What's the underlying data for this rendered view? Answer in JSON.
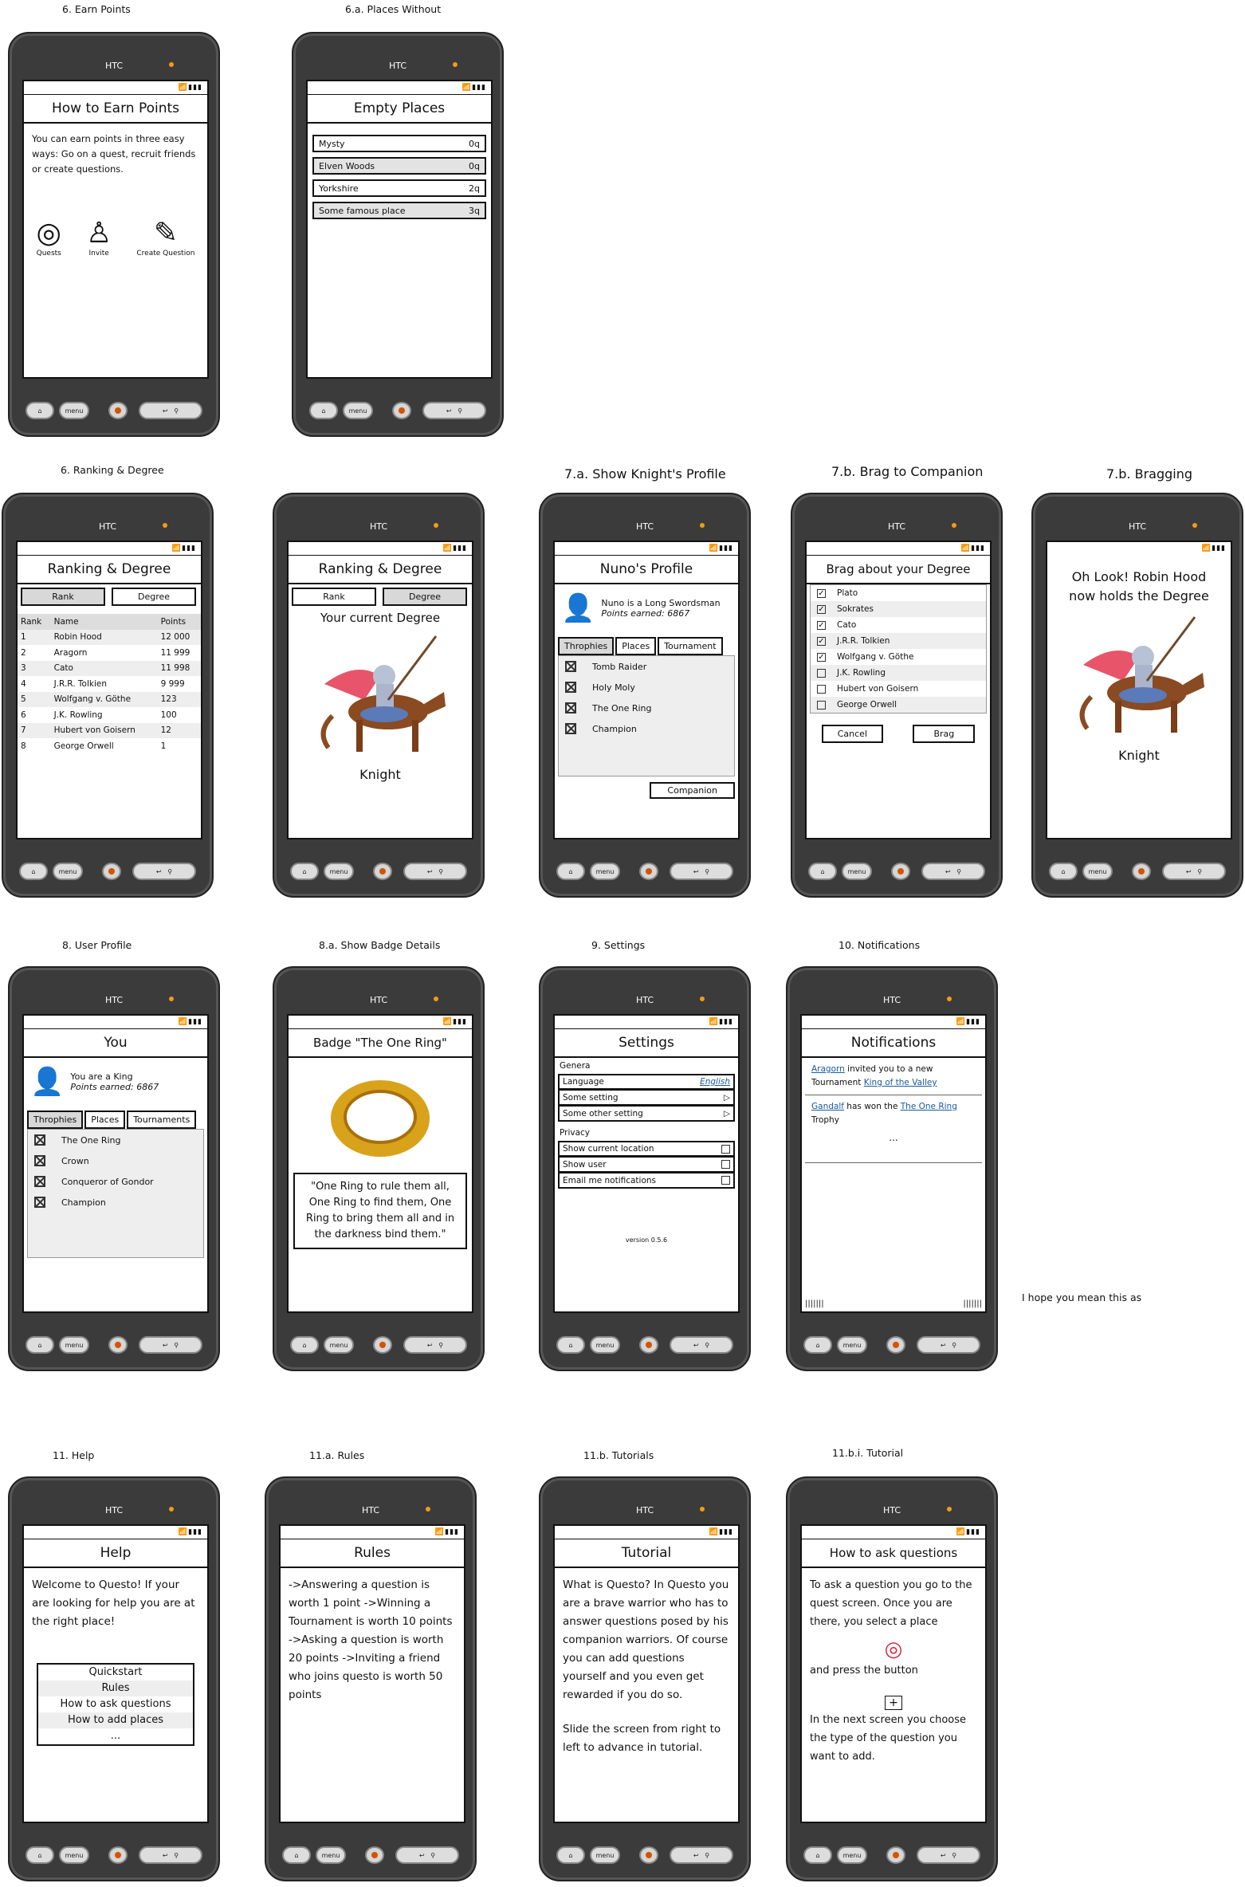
{
  "labels": {
    "earn": "6. Earn Points",
    "places": "6.a. Places Without",
    "ranking": "6. Ranking & Degree",
    "knight": "7.a. Show Knight's Profile",
    "brag": "7.b. Brag to Companion",
    "bragging": "7.b. Bragging",
    "user": "8. User Profile",
    "badge": "8.a. Show Badge Details",
    "settings": "9. Settings",
    "notif": "10. Notifications",
    "help": "11. Help",
    "rules": "11.a. Rules",
    "tutorials": "11.b. Tutorials",
    "tutorial": "11.b.i. Tutorial",
    "note": "I hope you mean this as"
  },
  "phone": {
    "brand": "HTC",
    "menu": "menu"
  },
  "earn": {
    "title": "How to Earn Points",
    "text": "You can earn points in three easy ways: Go on a quest, recruit friends or create questions.",
    "icons": [
      "Quests",
      "Invite",
      "Create Question"
    ]
  },
  "places": {
    "title": "Empty Places",
    "items": [
      {
        "name": "Mysty",
        "q": "0q"
      },
      {
        "name": "Elven Woods",
        "q": "0q"
      },
      {
        "name": "Yorkshire",
        "q": "2q"
      },
      {
        "name": "Some famous place",
        "q": "3q"
      }
    ]
  },
  "ranking": {
    "title": "Ranking & Degree",
    "tabs": [
      "Rank",
      "Degree"
    ],
    "headers": [
      "Rank",
      "Name",
      "Points"
    ],
    "rows": [
      [
        "1",
        "Robin Hood",
        "12 000"
      ],
      [
        "2",
        "Aragorn",
        "11 999"
      ],
      [
        "3",
        "Cato",
        "11 998"
      ],
      [
        "4",
        "J.R.R. Tolkien",
        "9 999"
      ],
      [
        "5",
        "Wolfgang v. Göthe",
        "123"
      ],
      [
        "6",
        "J.K. Rowling",
        "100"
      ],
      [
        "7",
        "Hubert von Goisern",
        "12"
      ],
      [
        "8",
        "George Orwell",
        "1"
      ]
    ],
    "degree_heading": "Your current Degree",
    "degree": "Knight"
  },
  "knight": {
    "title": "Nuno's Profile",
    "desc": "Nuno is a Long Swordsman",
    "points": "Points earned: 6867",
    "tabs": [
      "Throphies",
      "Places",
      "Tournament"
    ],
    "items": [
      "Tomb Raider",
      "Holy Moly",
      "The One Ring",
      "Champion"
    ],
    "button": "Companion"
  },
  "brag": {
    "title": "Brag about your Degree",
    "items": [
      {
        "name": "Plato",
        "checked": true
      },
      {
        "name": "Sokrates",
        "checked": true
      },
      {
        "name": "Cato",
        "checked": true
      },
      {
        "name": "J.R.R. Tolkien",
        "checked": true
      },
      {
        "name": "Wolfgang v. Göthe",
        "checked": true
      },
      {
        "name": "J.K. Rowling",
        "checked": false
      },
      {
        "name": "Hubert von Goisern",
        "checked": false
      },
      {
        "name": "George Orwell",
        "checked": false
      }
    ],
    "cancel": "Cancel",
    "brag": "Brag"
  },
  "bragging": {
    "text": "Oh Look! Robin Hood now holds the Degree",
    "degree": "Knight"
  },
  "user": {
    "title": "You",
    "desc": "You are a King",
    "points": "Points earned: 6867",
    "tabs": [
      "Throphies",
      "Places",
      "Tournaments"
    ],
    "items": [
      "The One Ring",
      "Crown",
      "Conqueror of Gondor",
      "Champion"
    ]
  },
  "badge": {
    "title": "Badge \"The One Ring\"",
    "quote": "\"One Ring to rule them all, One Ring to find them, One Ring to bring them all and in the darkness bind them.\""
  },
  "settings": {
    "title": "Settings",
    "general": "Genera",
    "language": "Language",
    "language_value": "English",
    "some": "Some setting",
    "other": "Some other setting",
    "privacy": "Privacy",
    "show_loc": "Show current location",
    "show_user": "Show user",
    "email": "Email me notifications",
    "version": "version 0.5.6"
  },
  "notif": {
    "title": "Notifications",
    "n1_user": "Aragorn",
    "n1_text": " invited you to a new Tournament ",
    "n1_link": "King of the Valley",
    "n2_user": "Gandalf",
    "n2_text": " has won the ",
    "n2_link": "The One Ring",
    "n2_tail": " Trophy",
    "more": "..."
  },
  "help": {
    "title": "Help",
    "text": "Welcome to Questo! If your are looking for help you are at the right place!",
    "items": [
      "Quickstart",
      "Rules",
      "How to ask questions",
      "How to add places",
      "..."
    ]
  },
  "rules": {
    "title": "Rules",
    "text": "->Answering a question is worth 1 point ->Winning a Tournament is worth 10 points ->Asking a question is worth 20 points ->Inviting a friend who joins questo is worth 50 points"
  },
  "tutorials": {
    "title": "Tutorial",
    "text": "What is Questo? In Questo you are a brave warrior who has to answer questions posed by his companion warriors. Of course you can add questions yourself and you even get rewarded if you do so.",
    "text2": "Slide the screen from right to left to advance in tutorial."
  },
  "tutorial": {
    "title": "How to ask questions",
    "text1": "To ask a question you go to the quest screen. Once you are there, you select a place",
    "text2": "and press the button",
    "text3": "In the next screen you choose the type of the question you want to add."
  }
}
